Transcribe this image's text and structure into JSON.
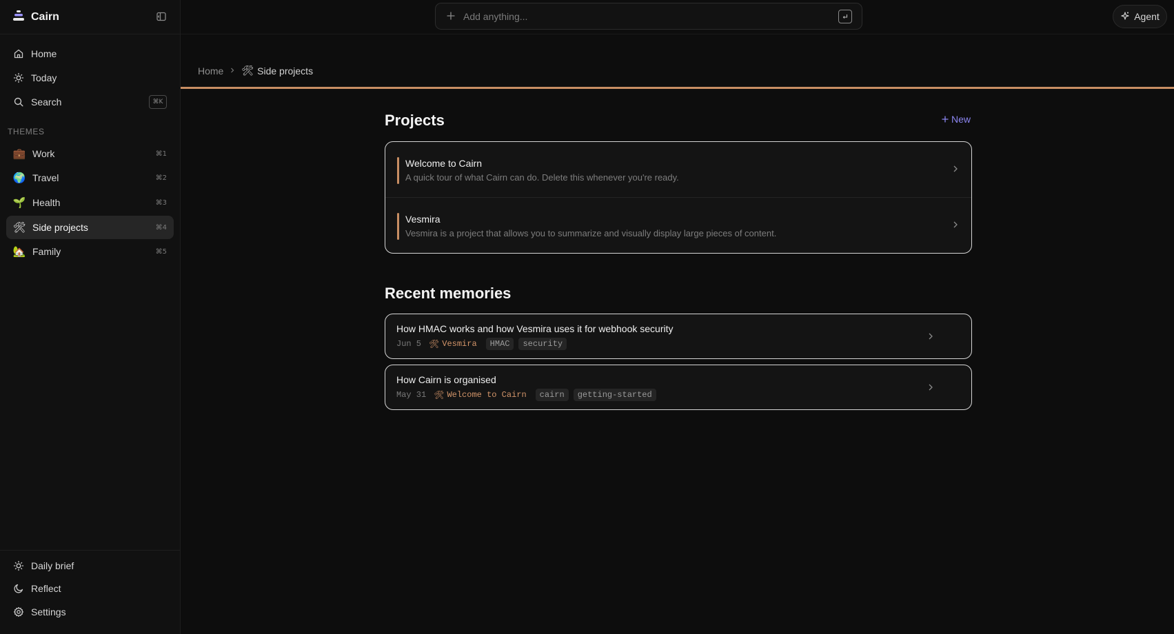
{
  "app": {
    "name": "Cairn"
  },
  "nav": {
    "home": "Home",
    "today": "Today",
    "search": "Search",
    "search_shortcut": "⌘K"
  },
  "themes": {
    "label": "THEMES",
    "items": [
      {
        "emoji": "💼",
        "label": "Work",
        "shortcut": "⌘1",
        "active": false
      },
      {
        "emoji": "🌍",
        "label": "Travel",
        "shortcut": "⌘2",
        "active": false
      },
      {
        "emoji": "🌱",
        "label": "Health",
        "shortcut": "⌘3",
        "active": false
      },
      {
        "emoji": "🛠",
        "label": "Side projects",
        "shortcut": "⌘4",
        "active": true
      },
      {
        "emoji": "🏡",
        "label": "Family",
        "shortcut": "⌘5",
        "active": false
      }
    ]
  },
  "footer_nav": {
    "daily_brief": "Daily brief",
    "reflect": "Reflect",
    "settings": "Settings"
  },
  "topbar": {
    "add_placeholder": "Add anything...",
    "agent_label": "Agent"
  },
  "breadcrumb": {
    "home": "Home",
    "current_icon": "🛠",
    "current": "Side projects"
  },
  "projects": {
    "title": "Projects",
    "new_label": "New",
    "items": [
      {
        "title": "Welcome to Cairn",
        "description": "A quick tour of what Cairn can do. Delete this whenever you're ready."
      },
      {
        "title": "Vesmira",
        "description": "Vesmira is a project that allows you to summarize and visually display large pieces of content."
      }
    ]
  },
  "memories": {
    "title": "Recent memories",
    "items": [
      {
        "title": "How HMAC works and how Vesmira uses it for webhook security",
        "date": "Jun 5",
        "project_icon": "🛠",
        "project": "Vesmira",
        "tags": [
          "HMAC",
          "security"
        ]
      },
      {
        "title": "How Cairn is organised",
        "date": "May 31",
        "project_icon": "🛠",
        "project": "Welcome to Cairn",
        "tags": [
          "cairn",
          "getting-started"
        ]
      }
    ]
  },
  "colors": {
    "accent": "#c88e63",
    "link": "#8b85f0",
    "background": "#0d0d0d",
    "sidebar": "#111111"
  }
}
